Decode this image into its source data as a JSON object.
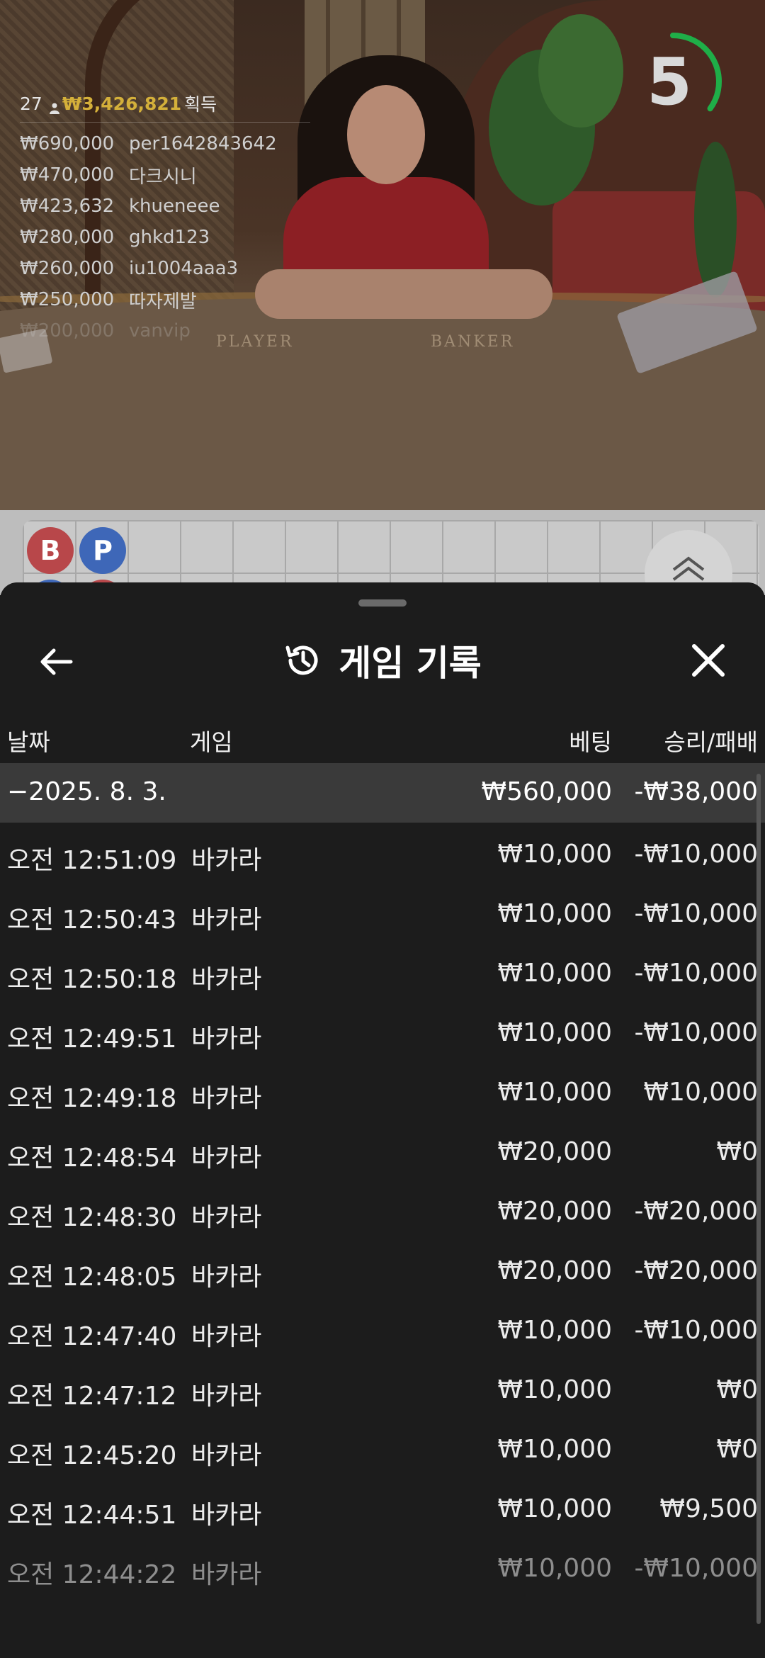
{
  "leaderboard": {
    "player_count": "27",
    "total_amount": "₩3,426,821",
    "total_suffix": "획득",
    "entries": [
      {
        "amount": "₩690,000",
        "name": "per1642843642"
      },
      {
        "amount": "₩470,000",
        "name": "다크시니"
      },
      {
        "amount": "₩423,632",
        "name": "khueneee"
      },
      {
        "amount": "₩280,000",
        "name": "ghkd123"
      },
      {
        "amount": "₩260,000",
        "name": "iu1004aaa3"
      },
      {
        "amount": "₩250,000",
        "name": "따자제발"
      },
      {
        "amount": "₩200,000",
        "name": "vanvip"
      }
    ]
  },
  "timer": {
    "value": "5",
    "progress": 0.35,
    "color": "#1fae48"
  },
  "table_labels": {
    "player": "PLAYER",
    "banker": "BANKER"
  },
  "road": {
    "beads": [
      {
        "label": "B",
        "color": "#b8474a"
      },
      {
        "label": "P",
        "color": "#3e67b8"
      }
    ]
  },
  "history": {
    "title": "게임 기록",
    "columns": {
      "date": "날짜",
      "game": "게임",
      "bet": "베팅",
      "result": "승리/패배"
    },
    "date_group": {
      "date": "−2025. 8. 3.",
      "bet": "₩560,000",
      "result": "-₩38,000"
    },
    "rows": [
      {
        "time": "오전 12:51:09",
        "game": "바카라",
        "bet": "₩10,000",
        "result": "-₩10,000"
      },
      {
        "time": "오전 12:50:43",
        "game": "바카라",
        "bet": "₩10,000",
        "result": "-₩10,000"
      },
      {
        "time": "오전 12:50:18",
        "game": "바카라",
        "bet": "₩10,000",
        "result": "-₩10,000"
      },
      {
        "time": "오전 12:49:51",
        "game": "바카라",
        "bet": "₩10,000",
        "result": "-₩10,000"
      },
      {
        "time": "오전 12:49:18",
        "game": "바카라",
        "bet": "₩10,000",
        "result": "₩10,000"
      },
      {
        "time": "오전 12:48:54",
        "game": "바카라",
        "bet": "₩20,000",
        "result": "₩0"
      },
      {
        "time": "오전 12:48:30",
        "game": "바카라",
        "bet": "₩20,000",
        "result": "-₩20,000"
      },
      {
        "time": "오전 12:48:05",
        "game": "바카라",
        "bet": "₩20,000",
        "result": "-₩20,000"
      },
      {
        "time": "오전 12:47:40",
        "game": "바카라",
        "bet": "₩10,000",
        "result": "-₩10,000"
      },
      {
        "time": "오전 12:47:12",
        "game": "바카라",
        "bet": "₩10,000",
        "result": "₩0"
      },
      {
        "time": "오전 12:45:20",
        "game": "바카라",
        "bet": "₩10,000",
        "result": "₩0"
      },
      {
        "time": "오전 12:44:51",
        "game": "바카라",
        "bet": "₩10,000",
        "result": "₩9,500"
      },
      {
        "time": "오전 12:44:22",
        "game": "바카라",
        "bet": "₩10,000",
        "result": "-₩10,000"
      }
    ]
  }
}
